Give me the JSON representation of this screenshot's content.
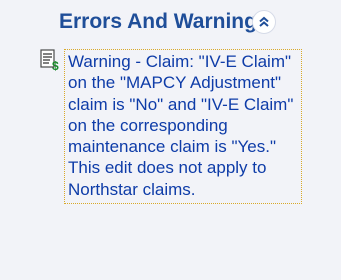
{
  "panel": {
    "title": "Errors And Warnings",
    "collapse_icon": "double-chevron-up-icon"
  },
  "message": {
    "icon": "document-dollar-icon",
    "text": "Warning - Claim:  \"IV-E Claim\" on the \"MAPCY Adjustment\" claim is \"No\" and \"IV-E Claim\" on the corresponding maintenance claim is \"Yes.\" This edit does not apply to Northstar claims."
  },
  "colors": {
    "title": "#1f4e99",
    "message_text": "#0e3ca8",
    "panel_background": "#f2f3f8",
    "message_border": "#d9a92a"
  }
}
